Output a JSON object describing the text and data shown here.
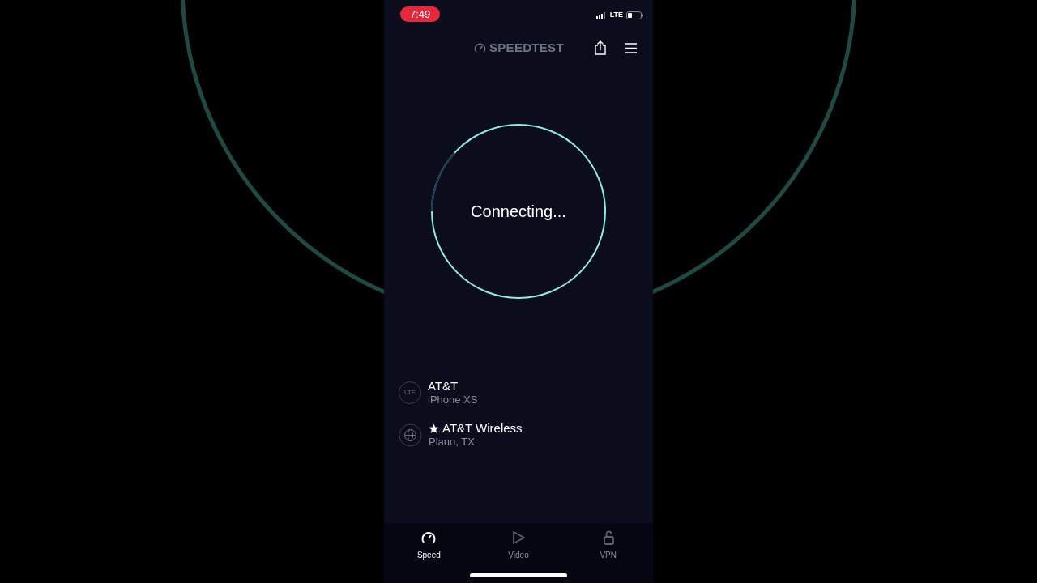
{
  "status_bar": {
    "time": "7:49",
    "network": "LTE"
  },
  "header": {
    "title": "SPEEDTEST"
  },
  "gauge": {
    "status": "Connecting..."
  },
  "connections": [
    {
      "kind": "network",
      "badge": "LTE",
      "title": "AT&T",
      "subtitle": "iPhone XS",
      "favorite": false
    },
    {
      "kind": "server",
      "title": "AT&T Wireless",
      "subtitle": "Plano, TX",
      "favorite": true
    }
  ],
  "tabs": [
    {
      "kind": "speed",
      "label": "Speed",
      "selected": true
    },
    {
      "kind": "video",
      "label": "Video",
      "selected": false
    },
    {
      "kind": "vpn",
      "label": "VPN",
      "selected": false
    }
  ]
}
